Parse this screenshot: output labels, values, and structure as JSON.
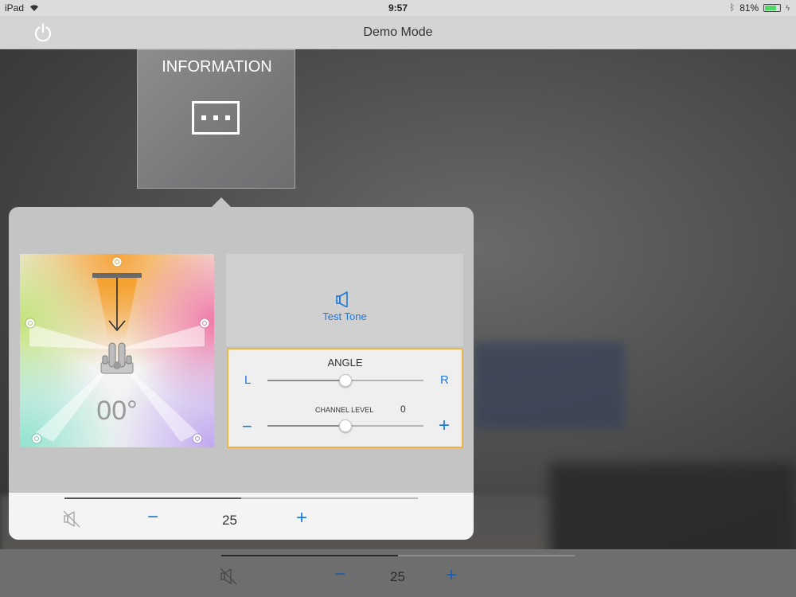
{
  "status_bar": {
    "device": "iPad",
    "time": "9:57",
    "battery": "81%",
    "battery_level": 0.81,
    "battery_color": "#4cd964"
  },
  "nav": {
    "title": "Demo Mode",
    "power_icon": "power-icon"
  },
  "info_tile": {
    "label": "INFORMATION",
    "icon": "ellipsis-box-icon"
  },
  "speaker_map": {
    "angle": "00°",
    "speaker_icon": "soundbar-icon",
    "direction_icon": "arrow-down-icon"
  },
  "test_tone": {
    "label": "Test Tone",
    "icon": "speaker-icon",
    "accent": "#1a7ae0"
  },
  "angle_control": {
    "title": "ANGLE",
    "left_label": "L",
    "right_label": "R",
    "level": 0.5
  },
  "channel_level": {
    "title": "CHANNEL LEVEL",
    "value": "0",
    "minus": "−",
    "plus": "+",
    "level": 0.5
  },
  "popover_volume": {
    "value": "25",
    "minus": "−",
    "plus": "+",
    "mute_icon": "mute-icon",
    "progress": 0.5
  },
  "main_volume": {
    "value": "25",
    "minus": "−",
    "plus": "+",
    "mute_icon": "mute-icon",
    "progress": 0.5
  },
  "colors": {
    "accent": "#1a7ae0",
    "highlight_border": "#f0b53e"
  }
}
